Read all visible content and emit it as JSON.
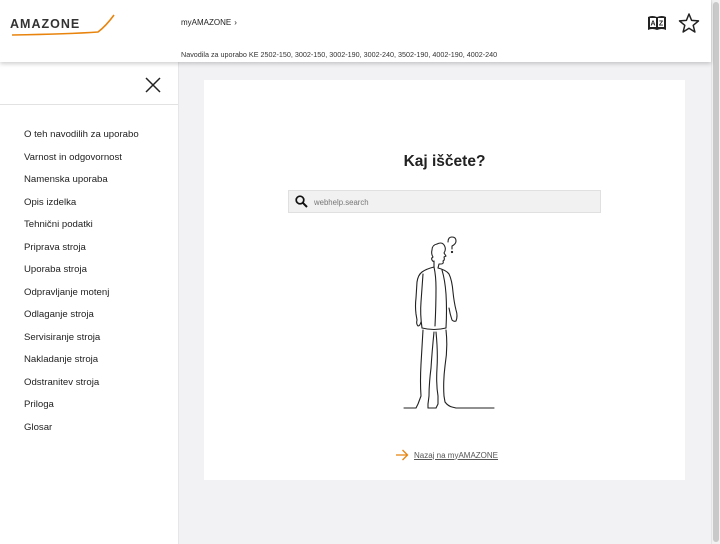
{
  "header": {
    "logo_text": "AMAZONE",
    "breadcrumb": "myAMAZONE",
    "breadcrumb_separator": "›",
    "subtitle": "Navodila za uporabo KE 2502-150, 3002-150, 3002-190, 3002-240, 3502-190, 4002-190, 4002-240",
    "dictionary_icon_glyphs": "A Z"
  },
  "sidebar": {
    "items": [
      {
        "label": "O teh navodilih za uporabo"
      },
      {
        "label": "Varnost in odgovornost"
      },
      {
        "label": "Namenska uporaba"
      },
      {
        "label": "Opis izdelka"
      },
      {
        "label": "Tehnični podatki"
      },
      {
        "label": "Priprava stroja"
      },
      {
        "label": "Uporaba stroja"
      },
      {
        "label": "Odpravljanje motenj"
      },
      {
        "label": "Odlaganje stroja"
      },
      {
        "label": "Servisiranje stroja"
      },
      {
        "label": "Nakladanje stroja"
      },
      {
        "label": "Odstranitev stroja"
      },
      {
        "label": "Priloga"
      },
      {
        "label": "Glosar"
      }
    ]
  },
  "main": {
    "headline": "Kaj iščete?",
    "search_placeholder": "webhelp.search",
    "back_link_label": "Nazaj na myAMAZONE"
  },
  "colors": {
    "brand_orange": "#e8840d",
    "background": "#f2f2f4"
  }
}
